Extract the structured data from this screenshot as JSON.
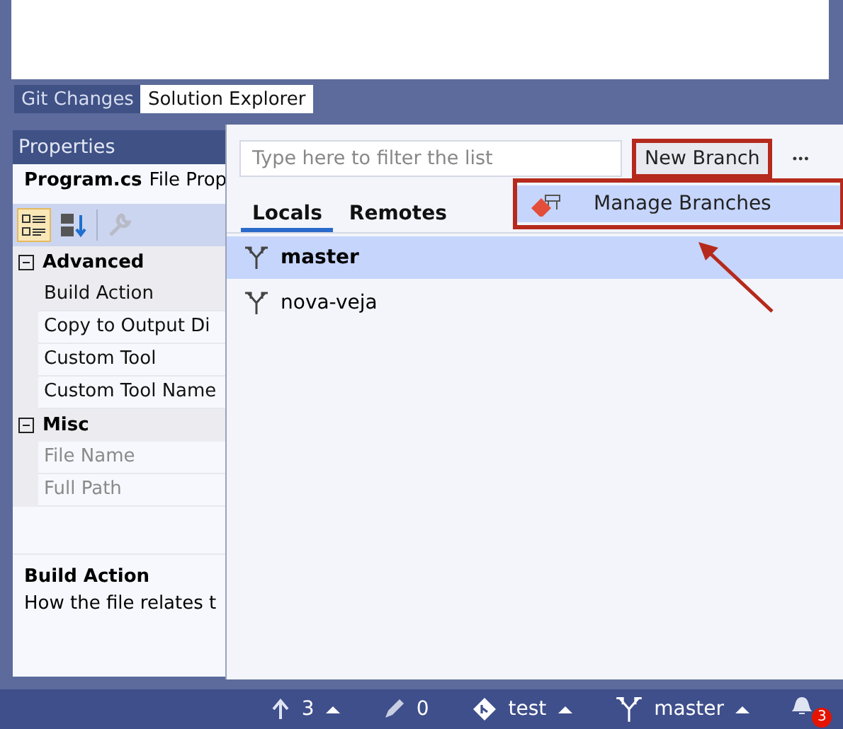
{
  "tabs": [
    {
      "label": "Git Changes",
      "selected": false
    },
    {
      "label": "Solution Explorer",
      "selected": true
    }
  ],
  "properties": {
    "title": "Properties",
    "object_name": "Program.cs",
    "object_type": "File Prop",
    "toolbar": [
      {
        "kind": "categorized",
        "selected": true
      },
      {
        "kind": "alphabetical",
        "selected": false
      },
      {
        "kind": "property-pages",
        "selected": false,
        "disabled": true
      }
    ],
    "rows": [
      {
        "kind": "category",
        "label": "Advanced",
        "expanded": true
      },
      {
        "kind": "property",
        "label": "Build Action",
        "disabled": false,
        "selected": true
      },
      {
        "kind": "property",
        "label": "Copy to Output Di",
        "disabled": false,
        "selected": false
      },
      {
        "kind": "property",
        "label": "Custom Tool",
        "disabled": false,
        "selected": false
      },
      {
        "kind": "property",
        "label": "Custom Tool Name",
        "disabled": false,
        "selected": false
      },
      {
        "kind": "category",
        "label": "Misc",
        "expanded": true
      },
      {
        "kind": "property",
        "label": "File Name",
        "disabled": true,
        "selected": false
      },
      {
        "kind": "property",
        "label": "Full Path",
        "disabled": true,
        "selected": false
      }
    ],
    "description_title": "Build Action",
    "description_text": "How the file relates t"
  },
  "branches_popup": {
    "filter": {
      "placeholder": "Type here to filter the list"
    },
    "new_branch": "New Branch",
    "more": "•••",
    "tabs": [
      {
        "label": "Locals",
        "selected": true
      },
      {
        "label": "Remotes",
        "selected": false
      }
    ],
    "branches": [
      {
        "name": "master",
        "selected": true
      },
      {
        "name": "nova-veja",
        "selected": false
      }
    ],
    "menu": [
      {
        "label": "Manage Branches",
        "selected": true
      }
    ]
  },
  "status_bar": [
    {
      "kind": "push",
      "text": "3"
    },
    {
      "kind": "changes",
      "text": "0"
    },
    {
      "kind": "repo",
      "text": "test"
    },
    {
      "kind": "branch",
      "text": "master"
    },
    {
      "kind": "notifications",
      "text": "3"
    }
  ]
}
